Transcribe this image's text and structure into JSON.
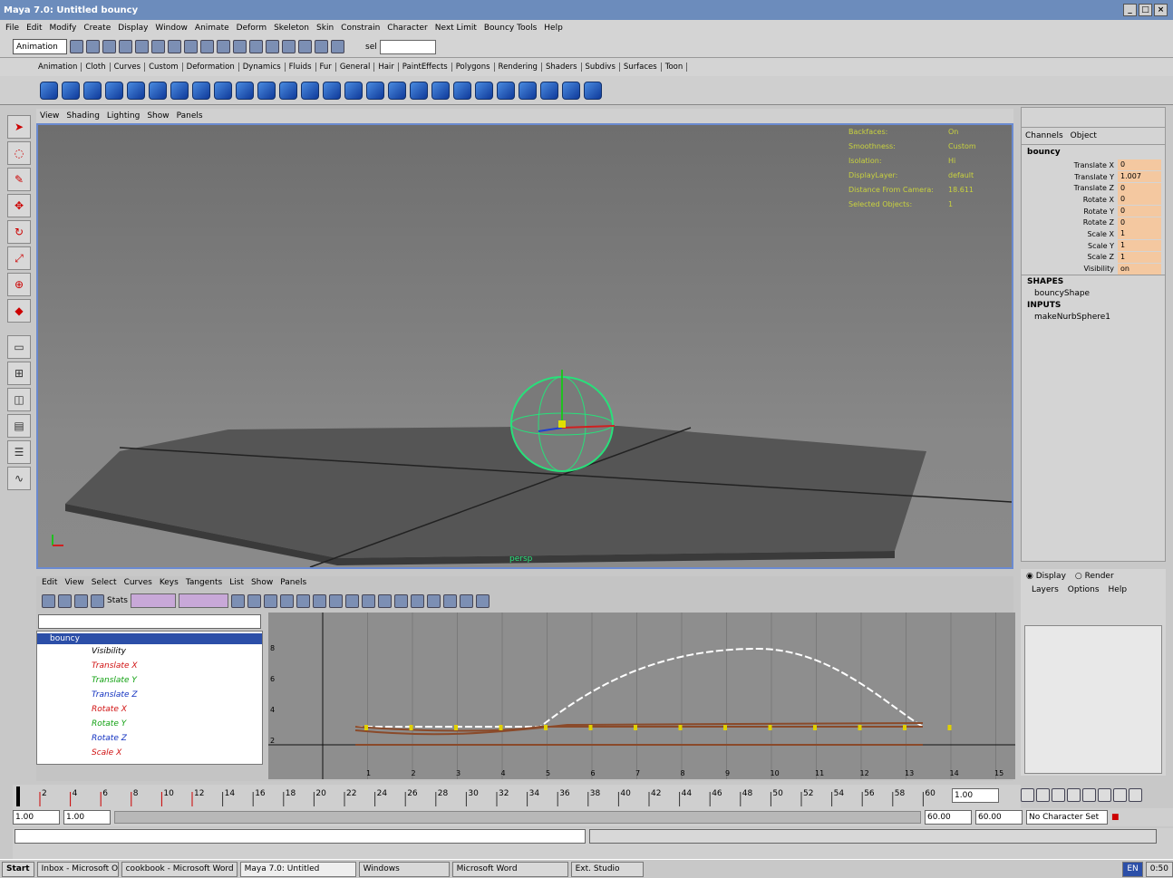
{
  "window": {
    "title": "Maya 7.0: Untitled    bouncy",
    "controls": [
      "_",
      "□",
      "×"
    ]
  },
  "menubar": [
    "File",
    "Edit",
    "Modify",
    "Create",
    "Display",
    "Window",
    "Animate",
    "Deform",
    "Skeleton",
    "Skin",
    "Constrain",
    "Character",
    "Next Limit",
    "Bouncy Tools",
    "Help"
  ],
  "status_line": {
    "mode": "Animation",
    "sel_label": "sel"
  },
  "shelf_tabs": [
    "Animation",
    "Cloth",
    "Curves",
    "Custom",
    "Deformation",
    "Dynamics",
    "Fluids",
    "Fur",
    "General",
    "Hair",
    "PaintEffects",
    "Polygons",
    "Rendering",
    "Shaders",
    "Subdivs",
    "Surfaces",
    "Toon"
  ],
  "viewport": {
    "menu": [
      "View",
      "Shading",
      "Lighting",
      "Show",
      "Panels"
    ],
    "camera": "persp",
    "hud": [
      {
        "label": "Backfaces:",
        "value": "On"
      },
      {
        "label": "Smoothness:",
        "value": "Custom"
      },
      {
        "label": "Isolation:",
        "value": "Hi"
      },
      {
        "label": "DisplayLayer:",
        "value": "default"
      },
      {
        "label": "Distance From Camera:",
        "value": "18.611"
      },
      {
        "label": "Selected Objects:",
        "value": "1"
      }
    ]
  },
  "channel_box": {
    "tabs": [
      "Channels",
      "Object"
    ],
    "object": "bouncy",
    "channels": [
      {
        "name": "Translate X",
        "value": "0"
      },
      {
        "name": "Translate Y",
        "value": "1.007"
      },
      {
        "name": "Translate Z",
        "value": "0"
      },
      {
        "name": "Rotate X",
        "value": "0"
      },
      {
        "name": "Rotate Y",
        "value": "0"
      },
      {
        "name": "Rotate Z",
        "value": "0"
      },
      {
        "name": "Scale X",
        "value": "1"
      },
      {
        "name": "Scale Y",
        "value": "1"
      },
      {
        "name": "Scale Z",
        "value": "1"
      },
      {
        "name": "Visibility",
        "value": "on"
      }
    ],
    "shapes_header": "SHAPES",
    "shape": "bouncyShape",
    "inputs_header": "INPUTS",
    "input": "makeNurbSphere1"
  },
  "layer_editor": {
    "display": "Display",
    "render": "Render",
    "menu": [
      "Layers",
      "Options",
      "Help"
    ]
  },
  "graph_editor": {
    "menu": [
      "Edit",
      "View",
      "Select",
      "Curves",
      "Keys",
      "Tangents",
      "List",
      "Show",
      "Panels"
    ],
    "stats_label": "Stats",
    "outliner_root": "bouncy",
    "outliner_items": [
      {
        "name": "Visibility",
        "color": "#000000"
      },
      {
        "name": "Translate X",
        "color": "#d01010"
      },
      {
        "name": "Translate Y",
        "color": "#10a010"
      },
      {
        "name": "Translate Z",
        "color": "#1030c0"
      },
      {
        "name": "Rotate X",
        "color": "#d01010"
      },
      {
        "name": "Rotate Y",
        "color": "#10a010"
      },
      {
        "name": "Rotate Z",
        "color": "#1030c0"
      },
      {
        "name": "Scale X",
        "color": "#d01010"
      }
    ],
    "y_ticks": [
      "8",
      "6",
      "4",
      "2"
    ],
    "x_ticks": [
      "1",
      "2",
      "3",
      "4",
      "5",
      "6",
      "7",
      "8",
      "9",
      "10",
      "11",
      "12",
      "13",
      "14",
      "15"
    ]
  },
  "timeline": {
    "ticks": [
      "2",
      "4",
      "6",
      "8",
      "10",
      "12",
      "14",
      "16",
      "18",
      "20",
      "22",
      "24",
      "26",
      "28",
      "30",
      "32",
      "34",
      "36",
      "38",
      "40",
      "42",
      "44",
      "46",
      "48",
      "50",
      "52",
      "54",
      "56",
      "58",
      "60"
    ],
    "current_frame": "1.00"
  },
  "range_slider": {
    "start": "1.00",
    "inner_start": "1.00",
    "inner_end": "60.00",
    "end": "60.00",
    "character_set": "No Character Set"
  },
  "taskbar": {
    "start": "Start",
    "items": [
      "Inbox - Microsoft Outlook",
      "cookbook - Microsoft Word",
      "Maya 7.0: Untitled",
      "Windows",
      "Microsoft Word",
      "Ext. Studio"
    ],
    "clock": "0:50",
    "lang": "EN"
  },
  "colors": {
    "viewport_border": "#6a8ad0",
    "hud_text": "#c9d23e",
    "channel_value_bg": "#f4c8a0",
    "curve_white": "#ffffff",
    "curve_brown": "#8a4a2a",
    "key_yellow": "#e0d000"
  }
}
